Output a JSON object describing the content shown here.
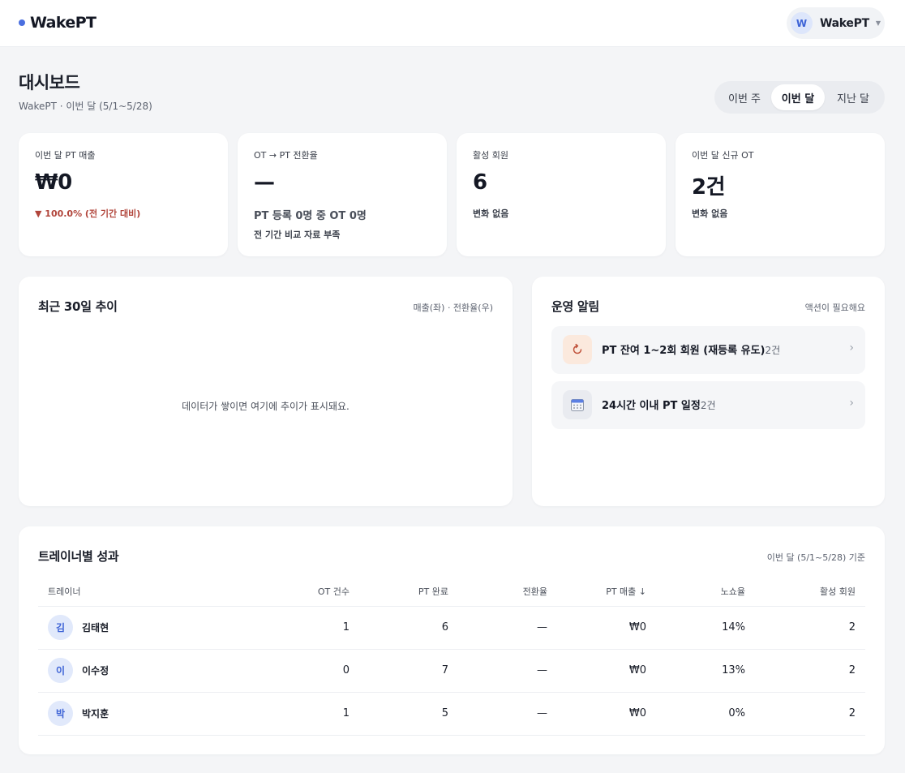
{
  "header": {
    "brand": "WakePT",
    "user_initial": "W",
    "user_name": "WakePT",
    "accent": "#4a6fe0"
  },
  "page": {
    "title": "대시보드",
    "subtitle": "WakePT · 이번 달 (5/1~5/28)",
    "period_tabs": [
      {
        "label": "이번 주",
        "active": false
      },
      {
        "label": "이번 달",
        "active": true
      },
      {
        "label": "지난 달",
        "active": false
      }
    ]
  },
  "kpis": [
    {
      "label": "이번 달 PT 매출",
      "value": "₩0",
      "delta": "▼ 100.0% (전 기간 대비)",
      "delta_color": "#b1453b"
    },
    {
      "label": "OT → PT 전환율",
      "value": "—",
      "note": "PT 등록 0명 중 OT 0명",
      "note2": "전 기간 비교 자료 부족"
    },
    {
      "label": "활성 회원",
      "value": "6",
      "note": "변화 없음"
    },
    {
      "label": "이번 달 신규 OT",
      "value": "2건",
      "note": "변화 없음"
    }
  ],
  "trend": {
    "title": "최근 30일 추이",
    "legend": "매출(좌) · 전환율(우)",
    "empty_message": "데이터가 쌓이면 여기에 추이가 표시돼요."
  },
  "alerts": {
    "title": "운영 알림",
    "hint": "액션이 필요해요",
    "items": [
      {
        "icon": "refresh-icon",
        "text": "PT 잔여 1~2회 회원 (재등록 유도)",
        "count": "2건"
      },
      {
        "icon": "calendar-icon",
        "text": "24시간 이내 PT 일정",
        "count": "2건"
      }
    ]
  },
  "trainers": {
    "title": "트레이너별 성과",
    "period": "이번 달 (5/1~5/28) 기준",
    "columns": [
      "트레이너",
      "OT 건수",
      "PT 완료",
      "전환율",
      "PT 매출 ↓",
      "노쇼율",
      "활성 회원"
    ],
    "rows": [
      {
        "initial": "김",
        "name": "김태현",
        "ot": "1",
        "pt_done": "6",
        "conversion": "—",
        "revenue": "₩0",
        "noshow": "14%",
        "active": "2"
      },
      {
        "initial": "이",
        "name": "이수정",
        "ot": "0",
        "pt_done": "7",
        "conversion": "—",
        "revenue": "₩0",
        "noshow": "13%",
        "active": "2"
      },
      {
        "initial": "박",
        "name": "박지훈",
        "ot": "1",
        "pt_done": "5",
        "conversion": "—",
        "revenue": "₩0",
        "noshow": "0%",
        "active": "2"
      }
    ]
  }
}
